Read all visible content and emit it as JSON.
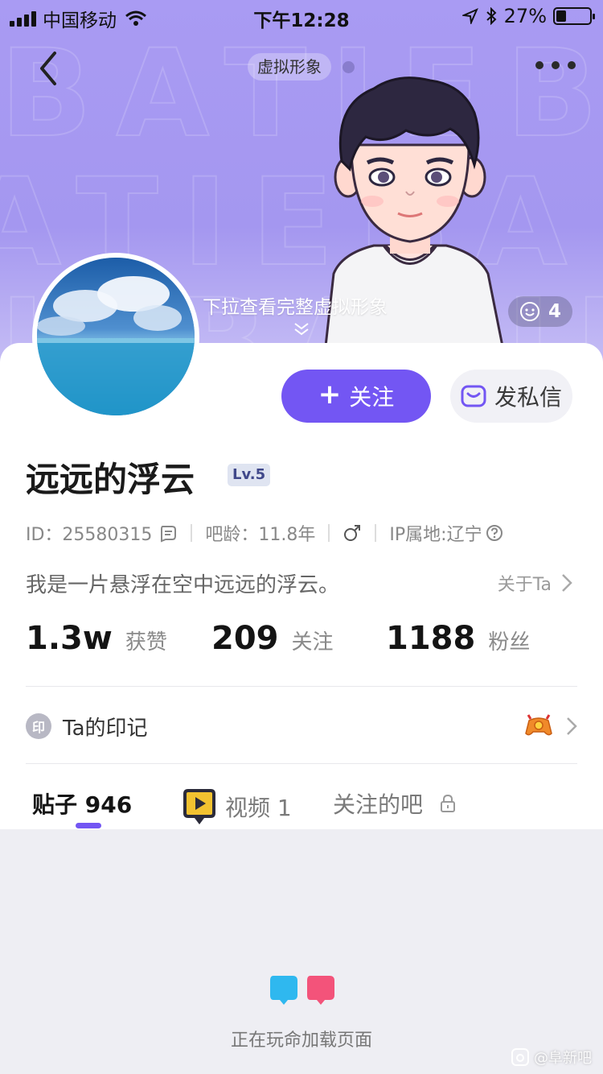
{
  "status_bar": {
    "carrier": "中国移动",
    "time": "下午12:28",
    "battery_percent": "27%",
    "battery_level": 0.27,
    "icons": [
      "signal-icon",
      "wifi-icon",
      "location-arrow-icon",
      "bluetooth-icon",
      "battery-icon"
    ]
  },
  "header": {
    "virtual_label": "虚拟形象",
    "pull_hint": "下拉查看完整虚拟形象",
    "like_count": "4"
  },
  "actions": {
    "follow_label": "关注",
    "message_label": "发私信"
  },
  "profile": {
    "name": "远远的浮云",
    "level": "Lv.5",
    "id_text": "ID：25580315",
    "bar_age": "吧龄：11.8年",
    "gender": "male",
    "ip": "IP属地:辽宁",
    "bio": "我是一片悬浮在空中远远的浮云。",
    "about_link": "关于Ta"
  },
  "stats": [
    {
      "value": "1.3w",
      "label": "获赞"
    },
    {
      "value": "209",
      "label": "关注"
    },
    {
      "value": "1188",
      "label": "粉丝"
    }
  ],
  "imprint": {
    "seal": "印",
    "title": "Ta的印记"
  },
  "tabs": [
    {
      "label": "贴子 946",
      "active": true
    },
    {
      "label": "视频 1",
      "active": false
    },
    {
      "label": "关注的吧",
      "active": false
    }
  ],
  "loading": {
    "text": "正在玩命加载页面"
  },
  "watermark": {
    "text": "@阜新吧"
  },
  "colors": {
    "accent": "#7356f3",
    "hero_bg": "#a99bf3"
  }
}
